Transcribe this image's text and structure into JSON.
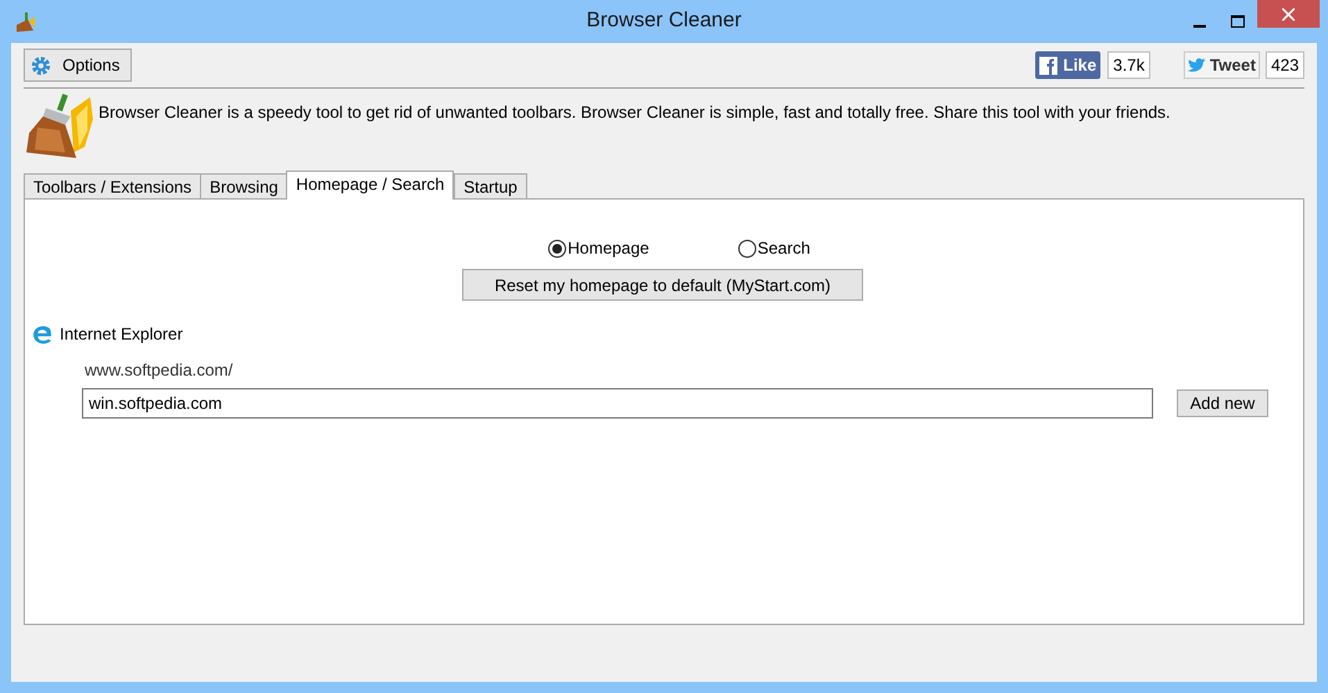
{
  "window": {
    "title": "Browser Cleaner"
  },
  "toolbar": {
    "options_button": "Options",
    "like": {
      "label": "Like",
      "count": "3.7k"
    },
    "tweet": {
      "label": "Tweet",
      "count": "423"
    }
  },
  "description": "Browser Cleaner is a speedy tool to get rid of unwanted toolbars. Browser Cleaner is simple, fast and totally free. Share this tool with your friends.",
  "tabs": [
    {
      "label": "Toolbars / Extensions",
      "selected": false
    },
    {
      "label": "Browsing",
      "selected": false
    },
    {
      "label": "Homepage / Search",
      "selected": true
    },
    {
      "label": "Startup",
      "selected": false
    }
  ],
  "mode": [
    {
      "label": "Homepage",
      "selected": true
    },
    {
      "label": "Search",
      "selected": false
    }
  ],
  "reset_button": "Reset my homepage to default (MyStart.com)",
  "browser": {
    "name": "Internet Explorer",
    "current_homepage": "www.softpedia.com/",
    "homepage_field": "win.softpedia.com",
    "add_button": "Add new"
  }
}
